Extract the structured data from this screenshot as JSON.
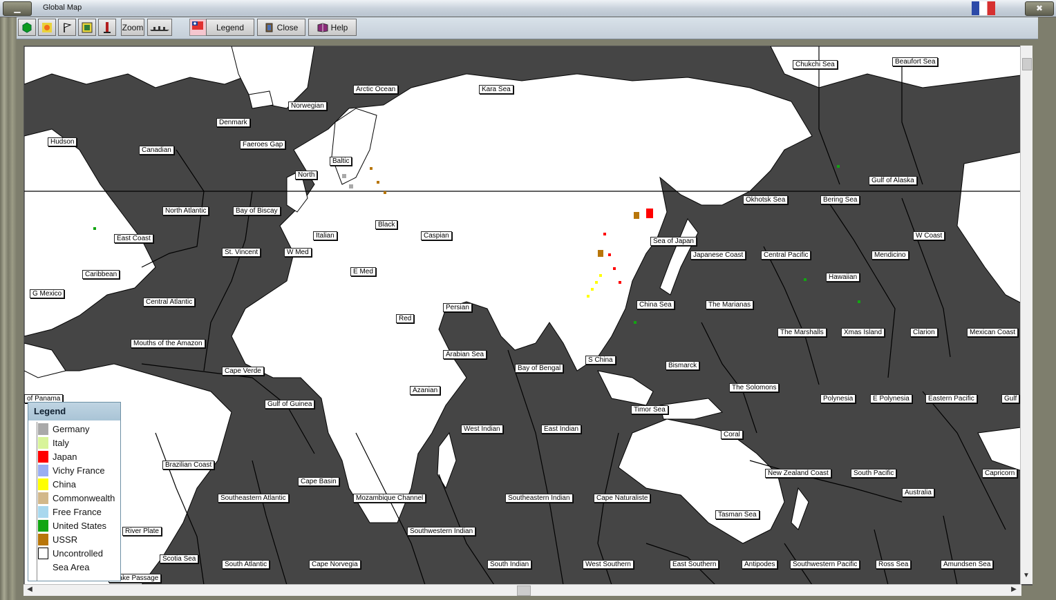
{
  "window": {
    "title": "Global Map"
  },
  "toolbar": {
    "zoom_label": "Zoom",
    "legend_label": "Legend",
    "close_label": "Close",
    "help_label": "Help",
    "icons": [
      "hexagon-icon",
      "sun-icon",
      "flag-icon",
      "frame-icon",
      "pillar-icon",
      "zoom",
      "ships-icon",
      "flag-swatch"
    ]
  },
  "map": {
    "labels": [
      "Arctic Ocean",
      "Kara Sea",
      "Chukchi Sea",
      "Beaufort Sea",
      "Norwegian",
      "Denmark",
      "Hudson",
      "Canadian",
      "Faeroes Gap",
      "Baltic",
      "North",
      "Gulf of Alaska",
      "Okhotsk Sea",
      "Bering Sea",
      "North Atlantic",
      "Bay of Biscay",
      "Black",
      "Caspian",
      "Italian",
      "Sea of Japan",
      "W Coast",
      "East Coast",
      "St. Vincent",
      "W Med",
      "Japanese Coast",
      "Central Pacific",
      "Mendicino",
      "E Med",
      "Caribbean",
      "Hawaiian",
      "G Mexico",
      "Central Atlantic",
      "Persian",
      "China Sea",
      "The Marianas",
      "Red",
      "The Marshalls",
      "Xmas Island",
      "Clarion",
      "Mexican Coast",
      "Mouths of the Amazon",
      "Arabian Sea",
      "S China",
      "Bismarck",
      "Bay of Bengal",
      "Cape Verde",
      "The Solomons",
      "Azanian",
      "of Panama",
      "Gulf of Guinea",
      "Polynesia",
      "E Polynesia",
      "Eastern Pacific",
      "Gulf",
      "Timor Sea",
      "West Indian",
      "East Indian",
      "Coral",
      "Brazilian Coast",
      "New Zealand Coast",
      "South Pacific",
      "Capricorn",
      "Cape Basin",
      "Australia",
      "Southeastern Atlantic",
      "Mozambique Channel",
      "Southeastern Indian",
      "Cape Naturaliste",
      "Tasman Sea",
      "River Plate",
      "Southwestern Indian",
      "Scotia Sea",
      "South Atlantic",
      "Cape Norvegia",
      "South Indian",
      "West Southern",
      "East Southern",
      "Antipodes",
      "Southwestern Pacific",
      "Ross Sea",
      "Amundsen Sea",
      "Drake Passage"
    ]
  },
  "legend": {
    "title": "Legend",
    "items": [
      {
        "label": "Germany",
        "color": "#a9a9a9"
      },
      {
        "label": "Italy",
        "color": "#d8f49a"
      },
      {
        "label": "Japan",
        "color": "#ff0000"
      },
      {
        "label": "Vichy France",
        "color": "#9aaef2"
      },
      {
        "label": "China",
        "color": "#ffff00"
      },
      {
        "label": "Commonwealth",
        "color": "#d2b88a"
      },
      {
        "label": "Free France",
        "color": "#a8d8ee"
      },
      {
        "label": "United States",
        "color": "#12a512"
      },
      {
        "label": "USSR",
        "color": "#b8760a"
      },
      {
        "label": "Uncontrolled",
        "color": "#ffffff"
      },
      {
        "label": "Sea Area",
        "color": "#ffffff"
      }
    ]
  },
  "colors": {
    "sea": "#454545",
    "land": "#ffffff",
    "border": "#000000"
  }
}
